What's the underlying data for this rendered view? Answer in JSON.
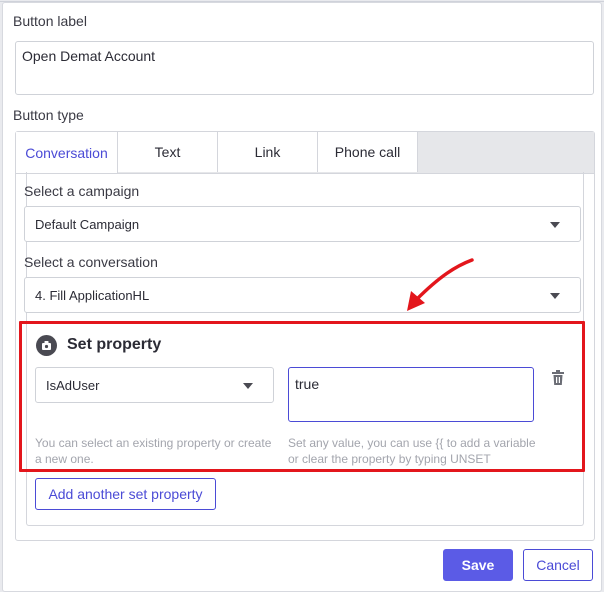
{
  "button_label": {
    "label": "Button label",
    "value": "Open Demat Account"
  },
  "button_type": {
    "label": "Button type",
    "tabs": [
      {
        "label": "Conversation",
        "active": true
      },
      {
        "label": "Text",
        "active": false
      },
      {
        "label": "Link",
        "active": false
      },
      {
        "label": "Phone call",
        "active": false
      }
    ]
  },
  "campaign": {
    "label": "Select a campaign",
    "selected": "Default Campaign"
  },
  "conversation": {
    "label": "Select a conversation",
    "selected": "4. Fill ApplicationHL"
  },
  "set_property": {
    "title": "Set property",
    "icon": "gear-icon",
    "property_selected": "IsAdUser",
    "value": "true",
    "property_hint": "You can select an existing property or create a new one.",
    "value_hint": "Set any value, you can use {{ to add a variable or clear the property by typing UNSET",
    "add_label": "Add another set property"
  },
  "footer": {
    "save_label": "Save",
    "cancel_label": "Cancel"
  },
  "colors": {
    "accent": "#4b4bd6",
    "primary": "#5b5be6",
    "highlight": "#e3161c"
  }
}
